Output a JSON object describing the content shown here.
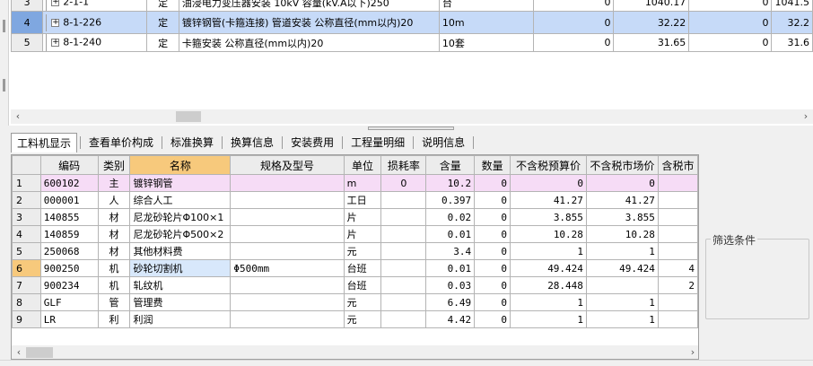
{
  "quota_rows": [
    {
      "no": "3",
      "code": "2-1-1",
      "type": "定",
      "name": "油浸电力变压器安装 10kV 容量(kV.A以下)250",
      "unit": "台",
      "c1": "0",
      "c2": "1040.17",
      "c3": "0",
      "c4": "1041.5"
    },
    {
      "no": "4",
      "code": "8-1-226",
      "type": "定",
      "name": "镀锌钢管(卡箍连接) 管道安装 公称直径(mm以内)20",
      "unit": "10m",
      "c1": "0",
      "c2": "32.22",
      "c3": "0",
      "c4": "32.2"
    },
    {
      "no": "5",
      "code": "8-1-240",
      "type": "定",
      "name": "卡箍安装 公称直径(mm以内)20",
      "unit": "10套",
      "c1": "0",
      "c2": "31.65",
      "c3": "0",
      "c4": "31.6"
    }
  ],
  "tabs": [
    "工料机显示",
    "查看单价构成",
    "标准换算",
    "换算信息",
    "安装费用",
    "工程量明细",
    "说明信息"
  ],
  "active_tab": 0,
  "resource_table": {
    "headers": [
      "",
      "编码",
      "类别",
      "名称",
      "规格及型号",
      "单位",
      "损耗率",
      "含量",
      "数量",
      "不含税预算价",
      "不含税市场价",
      "含税市"
    ],
    "rows": [
      {
        "no": "1",
        "code": "600102",
        "cat": "主",
        "name": "镀锌钢管",
        "spec": "",
        "unit": "m",
        "loss": "0",
        "content": "10.2",
        "qty": "0",
        "budget": "0",
        "market": "0",
        "tax": ""
      },
      {
        "no": "2",
        "code": "000001",
        "cat": "人",
        "name": "综合人工",
        "spec": "",
        "unit": "工日",
        "loss": "",
        "content": "0.397",
        "qty": "0",
        "budget": "41.27",
        "market": "41.27",
        "tax": ""
      },
      {
        "no": "3",
        "code": "140855",
        "cat": "材",
        "name": "尼龙砂轮片Φ100×1",
        "spec": "",
        "unit": "片",
        "loss": "",
        "content": "0.02",
        "qty": "0",
        "budget": "3.855",
        "market": "3.855",
        "tax": ""
      },
      {
        "no": "4",
        "code": "140859",
        "cat": "材",
        "name": "尼龙砂轮片Φ500×2",
        "spec": "",
        "unit": "片",
        "loss": "",
        "content": "0.01",
        "qty": "0",
        "budget": "10.28",
        "market": "10.28",
        "tax": ""
      },
      {
        "no": "5",
        "code": "250068",
        "cat": "材",
        "name": "其他材料费",
        "spec": "",
        "unit": "元",
        "loss": "",
        "content": "3.4",
        "qty": "0",
        "budget": "1",
        "market": "1",
        "tax": ""
      },
      {
        "no": "6",
        "code": "900250",
        "cat": "机",
        "name": "砂轮切割机",
        "spec": "Φ500mm",
        "unit": "台班",
        "loss": "",
        "content": "0.01",
        "qty": "0",
        "budget": "49.424",
        "market": "49.424",
        "tax": "4"
      },
      {
        "no": "7",
        "code": "900234",
        "cat": "机",
        "name": "轧纹机",
        "spec": "",
        "unit": "台班",
        "loss": "",
        "content": "0.03",
        "qty": "0",
        "budget": "28.448",
        "market": "",
        "tax": "2"
      },
      {
        "no": "8",
        "code": "GLF",
        "cat": "管",
        "name": "管理费",
        "spec": "",
        "unit": "元",
        "loss": "",
        "content": "6.49",
        "qty": "0",
        "budget": "1",
        "market": "1",
        "tax": ""
      },
      {
        "no": "9",
        "code": "LR",
        "cat": "利",
        "name": "利润",
        "spec": "",
        "unit": "元",
        "loss": "",
        "content": "4.42",
        "qty": "0",
        "budget": "1",
        "market": "1",
        "tax": ""
      }
    ]
  },
  "filter": {
    "title": "筛选条件"
  },
  "icons": {
    "expand": "plus-box-icon",
    "scroll_left": "arrow-left-icon",
    "scroll_right": "arrow-right-icon"
  },
  "colors": {
    "selected_row": "#c6daf8",
    "main_material_row": "#f6dcf6",
    "name_header": "#f7c97c"
  }
}
